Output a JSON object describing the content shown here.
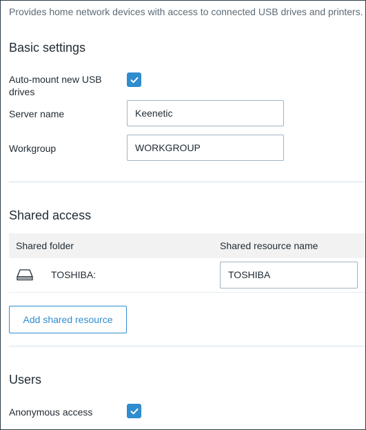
{
  "description": "Provides home network devices with access to connected USB drives and printers.",
  "basic_settings": {
    "title": "Basic settings",
    "automount_label": "Auto-mount new USB drives",
    "automount_checked": true,
    "server_name_label": "Server name",
    "server_name_value": "Keenetic",
    "workgroup_label": "Workgroup",
    "workgroup_value": "WORKGROUP"
  },
  "shared_access": {
    "title": "Shared access",
    "columns": [
      "Shared folder",
      "Shared resource name"
    ],
    "rows": [
      {
        "folder": "TOSHIBA:",
        "resource_name": "TOSHIBA",
        "icon": "usb-drive-icon"
      }
    ],
    "add_button_label": "Add shared resource"
  },
  "users": {
    "title": "Users",
    "anonymous_label": "Anonymous access",
    "anonymous_checked": true
  },
  "colors": {
    "accent": "#2f8ccf",
    "border": "#9fb3c1",
    "divider": "#d4e2ea",
    "table_header_bg": "#f2f2f2"
  }
}
